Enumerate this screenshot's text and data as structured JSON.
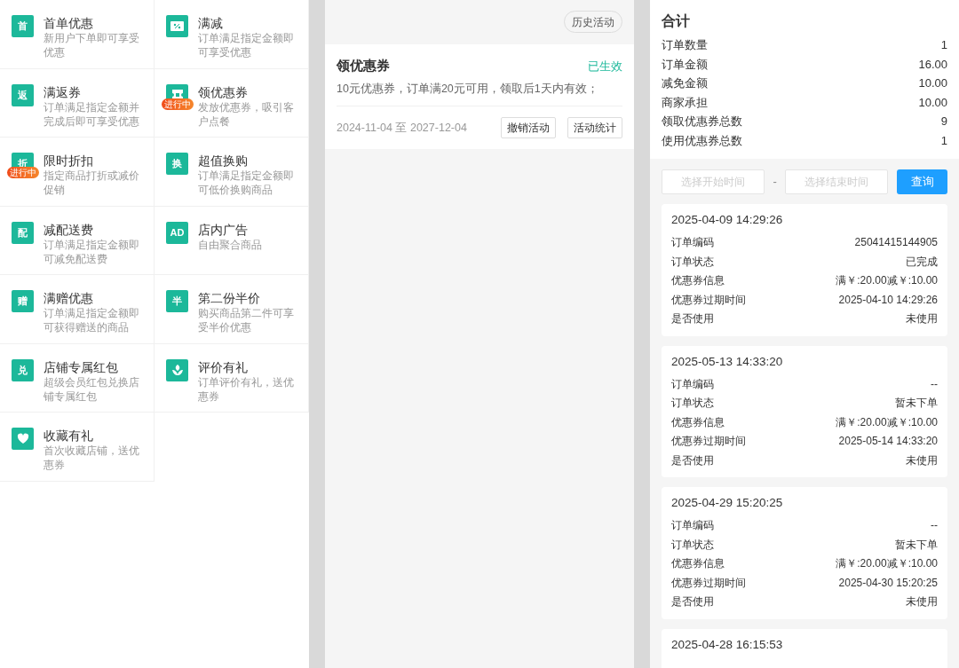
{
  "activities": [
    {
      "kind": "glyph",
      "icon_text": "首",
      "title": "首单优惠",
      "desc": "新用户下单即可享受优惠"
    },
    {
      "kind": "percent",
      "title": "满减",
      "desc": "订单满足指定金额即可享受优惠"
    },
    {
      "kind": "glyph",
      "icon_text": "返",
      "title": "满返券",
      "desc": "订单满足指定金额并完成后即可享受优惠"
    },
    {
      "kind": "ticket",
      "title": "领优惠券",
      "desc": "发放优惠券，吸引客户点餐",
      "badge": "进行中"
    },
    {
      "kind": "glyph",
      "icon_text": "折",
      "title": "限时折扣",
      "desc": "指定商品打折或减价促销",
      "badge": "进行中"
    },
    {
      "kind": "glyph",
      "icon_text": "换",
      "title": "超值换购",
      "desc": "订单满足指定金额即可低价换购商品"
    },
    {
      "kind": "glyph",
      "icon_text": "配",
      "title": "减配送费",
      "desc": "订单满足指定金额即可减免配送费"
    },
    {
      "kind": "glyph",
      "icon_text": "AD",
      "title": "店内广告",
      "desc": "自由聚合商品"
    },
    {
      "kind": "glyph",
      "icon_text": "赠",
      "title": "满赠优惠",
      "desc": "订单满足指定金额即可获得赠送的商品"
    },
    {
      "kind": "glyph",
      "icon_text": "半",
      "title": "第二份半价",
      "desc": "购买商品第二件可享受半价优惠"
    },
    {
      "kind": "glyph",
      "icon_text": "兑",
      "title": "店铺专属红包",
      "desc": "超级会员红包兑换店铺专属红包"
    },
    {
      "kind": "flower",
      "title": "评价有礼",
      "desc": "订单评价有礼，送优惠券"
    },
    {
      "kind": "heart",
      "title": "收藏有礼",
      "desc": "首次收藏店铺，送优惠券"
    }
  ],
  "history_button": "历史活动",
  "campaign": {
    "title": "领优惠券",
    "status": "已生效",
    "desc": "10元优惠券，订单满20元可用，领取后1天内有效；",
    "period": "2024-11-04 至 2027-12-04",
    "buttons": [
      "撤销活动",
      "活动统计"
    ]
  },
  "summary": {
    "title": "合计",
    "rows": [
      {
        "label": "订单数量",
        "value": "1"
      },
      {
        "label": "订单金额",
        "value": "16.00"
      },
      {
        "label": "减免金额",
        "value": "10.00"
      },
      {
        "label": "商家承担",
        "value": "10.00"
      },
      {
        "label": "领取优惠券总数",
        "value": "9"
      },
      {
        "label": "使用优惠券总数",
        "value": "1"
      }
    ]
  },
  "filter": {
    "start_placeholder": "选择开始时间",
    "separator": "-",
    "end_placeholder": "选择结束时间",
    "query_button": "查询"
  },
  "records": [
    {
      "time": "2025-04-09 14:29:26",
      "fields": [
        {
          "label": "订单编码",
          "value": "25041415144905"
        },
        {
          "label": "订单状态",
          "value": "已完成"
        },
        {
          "label": "优惠券信息",
          "value": "满￥:20.00减￥:10.00"
        },
        {
          "label": "优惠券过期时间",
          "value": "2025-04-10 14:29:26"
        },
        {
          "label": "是否使用",
          "value": "未使用"
        }
      ]
    },
    {
      "time": "2025-05-13 14:33:20",
      "fields": [
        {
          "label": "订单编码",
          "value": "--"
        },
        {
          "label": "订单状态",
          "value": "暂未下单"
        },
        {
          "label": "优惠券信息",
          "value": "满￥:20.00减￥:10.00"
        },
        {
          "label": "优惠券过期时间",
          "value": "2025-05-14 14:33:20"
        },
        {
          "label": "是否使用",
          "value": "未使用"
        }
      ]
    },
    {
      "time": "2025-04-29 15:20:25",
      "fields": [
        {
          "label": "订单编码",
          "value": "--"
        },
        {
          "label": "订单状态",
          "value": "暂未下单"
        },
        {
          "label": "优惠券信息",
          "value": "满￥:20.00减￥:10.00"
        },
        {
          "label": "优惠券过期时间",
          "value": "2025-04-30 15:20:25"
        },
        {
          "label": "是否使用",
          "value": "未使用"
        }
      ]
    },
    {
      "time": "2025-04-28 16:15:53"
    }
  ]
}
